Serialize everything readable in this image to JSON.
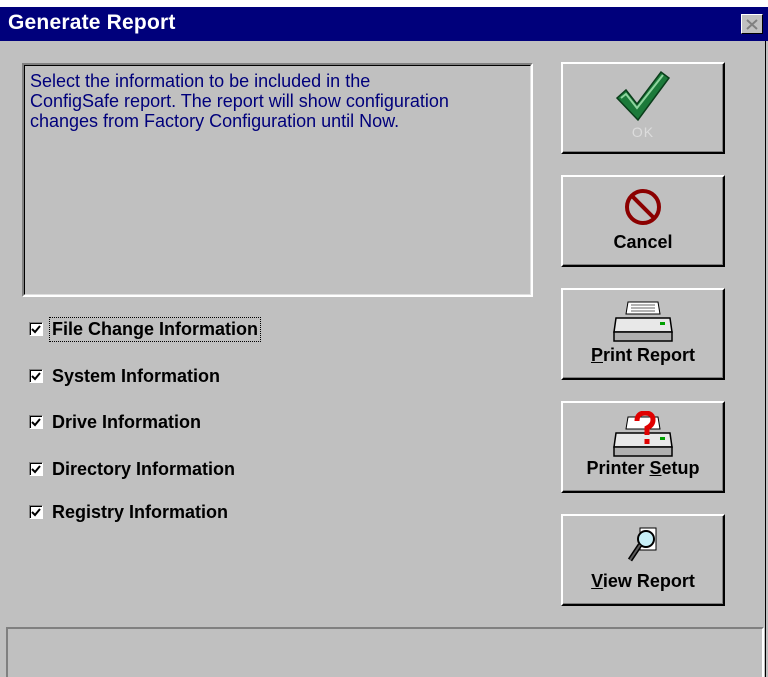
{
  "window": {
    "title": "Generate Report",
    "close_icon": "close-icon"
  },
  "description": "Select the information to be included in the\nConfigSafe report.  The report will show configuration\nchanges from Factory Configuration until Now.",
  "options": [
    {
      "label": "File Change Information",
      "checked": true,
      "focused": true
    },
    {
      "label": "System Information",
      "checked": true
    },
    {
      "label": "Drive Information",
      "checked": true
    },
    {
      "label": "Directory Information",
      "checked": true
    },
    {
      "label": "Registry Information",
      "checked": true
    }
  ],
  "buttons": {
    "ok": {
      "label": "OK",
      "enabled": false,
      "icon": "checkmark-icon"
    },
    "cancel": {
      "label": "Cancel",
      "icon": "no-symbol-icon"
    },
    "print": {
      "mnemonic": "P",
      "rest": "rint Report",
      "icon": "printer-icon"
    },
    "setup": {
      "prefix": "Printer ",
      "mnemonic": "S",
      "rest": "etup",
      "icon": "printer-question-icon"
    },
    "view": {
      "mnemonic": "V",
      "rest": "iew Report",
      "icon": "magnifier-icon"
    }
  },
  "colors": {
    "titlebar": "#00007b",
    "description_text": "#00007b",
    "face": "#c0c0c0"
  }
}
